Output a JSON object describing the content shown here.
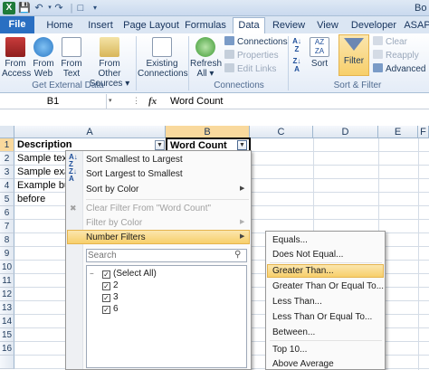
{
  "titlebar": {
    "title": "Bo"
  },
  "tabs": [
    {
      "label": "File"
    },
    {
      "label": "Home"
    },
    {
      "label": "Insert"
    },
    {
      "label": "Page Layout"
    },
    {
      "label": "Formulas"
    },
    {
      "label": "Data"
    },
    {
      "label": "Review"
    },
    {
      "label": "View"
    },
    {
      "label": "Developer"
    },
    {
      "label": "ASAP"
    }
  ],
  "ribbon": {
    "get_external": {
      "from_access": "From Access",
      "from_web": "From Web",
      "from_text": "From Text",
      "from_other": "From Other Sources",
      "label": "Get External Data"
    },
    "existing": "Existing Connections",
    "connections": {
      "refresh": "Refresh All",
      "connections": "Connections",
      "properties": "Properties",
      "edit_links": "Edit Links",
      "label": "Connections"
    },
    "sort_filter": {
      "sort": "Sort",
      "filter": "Filter",
      "clear": "Clear",
      "reapply": "Reapply",
      "advanced": "Advanced",
      "label": "Sort & Filter"
    }
  },
  "formula_bar": {
    "name_box": "B1",
    "fx": "fx",
    "value": "Word Count"
  },
  "columns": [
    "A",
    "B",
    "C",
    "D",
    "E",
    "F"
  ],
  "rows": [
    "1",
    "2",
    "3",
    "4",
    "5",
    "6",
    "7",
    "8",
    "9",
    "10",
    "11",
    "12",
    "13",
    "14",
    "15",
    "16"
  ],
  "cells": {
    "a1": "Description",
    "b1": "Word Count",
    "a2": "Sample tex",
    "a3": "Sample exa",
    "a4": "Example bu",
    "a5": "before"
  },
  "menu": {
    "sort_asc": "Sort Smallest to Largest",
    "sort_desc": "Sort Largest to Smallest",
    "sort_color": "Sort by Color",
    "clear_filter": "Clear Filter From \"Word Count\"",
    "filter_color": "Filter by Color",
    "number_filters": "Number Filters",
    "search_placeholder": "Search",
    "values": [
      "(Select All)",
      "2",
      "3",
      "6"
    ]
  },
  "submenu": [
    "Equals...",
    "Does Not Equal...",
    "Greater Than...",
    "Greater Than Or Equal To...",
    "Less Than...",
    "Less Than Or Equal To...",
    "Between...",
    "Top 10...",
    "Above Average"
  ]
}
